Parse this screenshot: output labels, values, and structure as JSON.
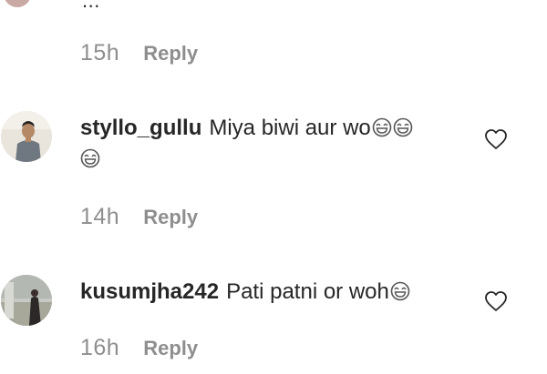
{
  "top_fragment": "...",
  "first_meta": {
    "time": "15h",
    "reply": "Reply"
  },
  "comments": [
    {
      "username": "styllo_gullu",
      "text": "Miya biwi aur wo",
      "emoji_count": 3,
      "emoji_icon": "laughing-face-icon",
      "time": "14h",
      "reply": "Reply",
      "like_icon": "heart-outline-icon"
    },
    {
      "username": "kusumjha242",
      "text": "Pati patni or woh",
      "emoji_count": 1,
      "emoji_icon": "laughing-face-icon",
      "time": "16h",
      "reply": "Reply",
      "like_icon": "heart-outline-icon"
    }
  ],
  "colors": {
    "text": "#262626",
    "meta": "#8e8e8e",
    "background": "#ffffff"
  }
}
